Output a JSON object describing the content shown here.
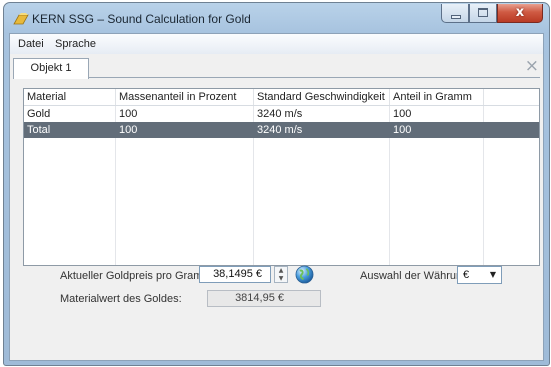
{
  "window": {
    "title": "KERN SSG – Sound Calculation for Gold",
    "close_glyph": "x"
  },
  "menu": {
    "items": [
      "Datei",
      "Sprache"
    ]
  },
  "tabs": {
    "items": [
      {
        "label": "Objekt 1"
      }
    ],
    "close_glyph": "×"
  },
  "table": {
    "columns": [
      "Material",
      "Massenanteil in Prozent",
      "Standard Geschwindigkeit",
      "Anteil in Gramm"
    ],
    "rows": [
      {
        "material": "Gold",
        "percent": "100",
        "speed": "3240 m/s",
        "grams": "100"
      },
      {
        "material": "Total",
        "percent": "100",
        "speed": "3240 m/s",
        "grams": "100"
      }
    ],
    "selected_row": 1
  },
  "form": {
    "gold_price_label": "Aktueller Goldpreis pro Gramm:",
    "gold_price_value": "38,1495 €",
    "currency_label": "Auswahl der Währung:",
    "currency_value": "€",
    "material_value_label": "Materialwert des Goldes:",
    "material_value": "3814,95 €"
  },
  "colors": {
    "selected_row_bg": "#626d79",
    "title_bar": "#b9d2e9",
    "close_button": "#cf5a43"
  },
  "icons": {
    "app": "gold-bar-icon",
    "update_price": "globe-icon",
    "spinner_up": "▲",
    "spinner_down": "▼",
    "dropdown": "▼"
  }
}
